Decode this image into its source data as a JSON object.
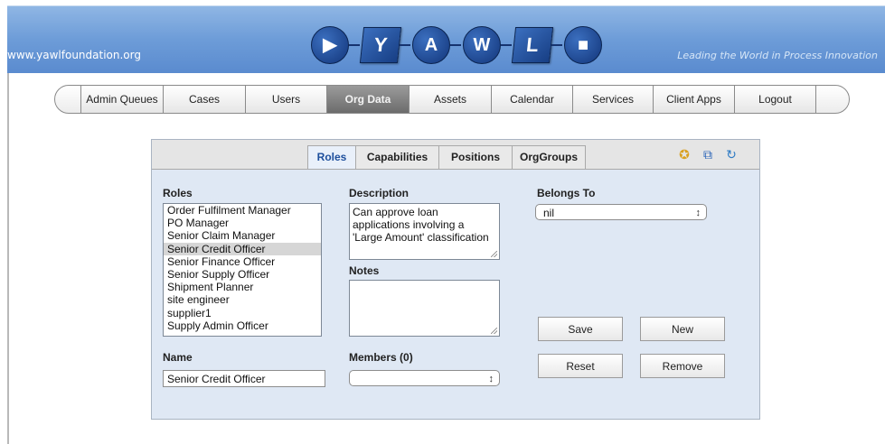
{
  "header": {
    "site_url": "www.yawlfoundation.org",
    "tagline": "Leading the World in Process Innovation",
    "logo_letters": [
      "Y",
      "A",
      "W",
      "L"
    ]
  },
  "nav": {
    "items": [
      {
        "label": "Admin Queues"
      },
      {
        "label": "Cases"
      },
      {
        "label": "Users"
      },
      {
        "label": "Org Data",
        "active": true
      },
      {
        "label": "Assets"
      },
      {
        "label": "Calendar"
      },
      {
        "label": "Services"
      },
      {
        "label": "Client Apps"
      },
      {
        "label": "Logout"
      }
    ]
  },
  "panel": {
    "tabs": [
      {
        "label": "Roles",
        "active": true
      },
      {
        "label": "Capabilities"
      },
      {
        "label": "Positions"
      },
      {
        "label": "OrgGroups"
      }
    ],
    "toolbar_icons": [
      "import-icon",
      "copy-icon",
      "refresh-icon"
    ],
    "roles": {
      "label": "Roles",
      "items": [
        "Order Fulfilment Manager",
        "PO Manager",
        "Senior Claim Manager",
        "Senior Credit Officer",
        "Senior Finance Officer",
        "Senior Supply Officer",
        "Shipment Planner",
        "site engineer",
        "supplier1",
        "Supply Admin Officer"
      ],
      "selected": "Senior Credit Officer"
    },
    "description": {
      "label": "Description",
      "value": "Can approve loan applications involving a 'Large Amount' classification"
    },
    "notes": {
      "label": "Notes",
      "value": ""
    },
    "belongs_to": {
      "label": "Belongs To",
      "value": "nil"
    },
    "name": {
      "label": "Name",
      "value": "Senior Credit Officer"
    },
    "members": {
      "label": "Members (0)",
      "value": ""
    },
    "buttons": {
      "save": "Save",
      "new": "New",
      "reset": "Reset",
      "remove": "Remove"
    }
  },
  "colors": {
    "header_blue": "#6d9cd8",
    "panel_bg": "#dfe8f4",
    "active_tab_text": "#1e4f9c",
    "nav_active_bg": "#7a7a7a"
  }
}
